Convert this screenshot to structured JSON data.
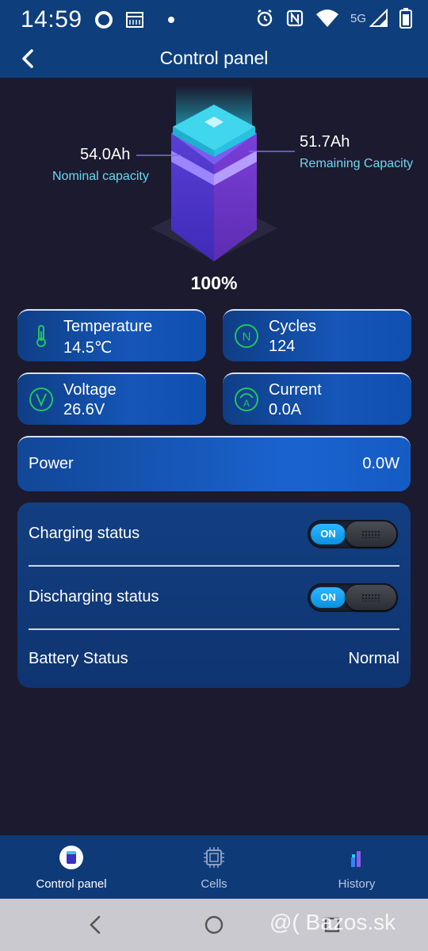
{
  "status_bar": {
    "time": "14:59",
    "network": "5G",
    "icons": [
      "circle-icon",
      "calendar-icon",
      "dot-icon",
      "alarm-icon",
      "nfc-icon",
      "wifi-icon",
      "signal-icon",
      "battery-icon"
    ]
  },
  "app_bar": {
    "title": "Control panel",
    "back_icon": "back-arrow-icon"
  },
  "battery_overview": {
    "nominal_capacity_value": "54.0Ah",
    "nominal_capacity_label": "Nominal capacity",
    "remaining_capacity_value": "51.7Ah",
    "remaining_capacity_label": "Remaining Capacity",
    "percent": "100%"
  },
  "metrics": [
    {
      "label": "Temperature",
      "value": "14.5℃",
      "icon": "thermometer-icon"
    },
    {
      "label": "Cycles",
      "value": "124",
      "icon": "cycles-n-icon"
    },
    {
      "label": "Voltage",
      "value": "26.6V",
      "icon": "voltage-v-icon"
    },
    {
      "label": "Current",
      "value": "0.0A",
      "icon": "current-a-icon"
    }
  ],
  "power": {
    "label": "Power",
    "value": "0.0W"
  },
  "status_panel": {
    "charging_label": "Charging status",
    "charging_toggle": "ON",
    "discharging_label": "Discharging status",
    "discharging_toggle": "ON",
    "battery_status_label": "Battery Status",
    "battery_status_value": "Normal"
  },
  "bottom_nav": [
    {
      "label": "Control panel",
      "icon": "battery-cube-icon",
      "active": true
    },
    {
      "label": "Cells",
      "icon": "chip-icon",
      "active": false
    },
    {
      "label": "History",
      "icon": "bar-chart-icon",
      "active": false
    }
  ],
  "system_nav": {
    "watermark": "@( Bazos.sk"
  },
  "colors": {
    "background": "#1c1a2e",
    "header": "#0e3f7c",
    "accent_cyan": "#6fd6f2",
    "icon_green": "#22c55e",
    "toggle_on": "#1aa3f0"
  }
}
